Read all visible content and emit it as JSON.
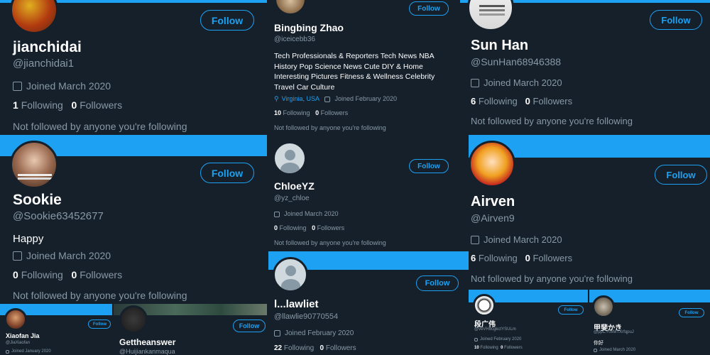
{
  "colors": {
    "bg": "#15202b",
    "accent": "#1da1f2",
    "muted": "#8899a6",
    "text": "#ffffff"
  },
  "follow_label": "Follow",
  "profiles": {
    "jianchidai": {
      "name": "jianchidai",
      "handle": "@jianchidai1",
      "joined": "Joined March 2020",
      "following": "1",
      "followers": "0",
      "following_label": "Following",
      "followers_label": "Followers",
      "note": "Not followed by anyone you're following"
    },
    "bingbing": {
      "name": "Bingbing Zhao",
      "handle": "@iceicebb36",
      "bio": "Tech Professionals & Reporters Tech News NBA History Pop Science News Cute DIY & Home Interesting Pictures Fitness & Wellness Celebrity Travel Car Culture",
      "location": "Virginia, USA",
      "joined": "Joined February 2020",
      "following": "10",
      "followers": "0",
      "following_label": "Following",
      "followers_label": "Followers",
      "note": "Not followed by anyone you're following"
    },
    "sunhan": {
      "name": "Sun Han",
      "handle": "@SunHan68946388",
      "joined": "Joined March 2020",
      "following": "6",
      "followers": "0",
      "following_label": "Following",
      "followers_label": "Followers",
      "note": "Not followed by anyone you're following"
    },
    "sookie": {
      "name": "Sookie",
      "handle": "@Sookie63452677",
      "bio": "Happy",
      "joined": "Joined March 2020",
      "following": "0",
      "followers": "0",
      "following_label": "Following",
      "followers_label": "Followers",
      "note": "Not followed by anyone you're following"
    },
    "chloe": {
      "name": "ChloeYZ",
      "handle": "@yz_chloe",
      "joined": "Joined March 2020",
      "following": "0",
      "followers": "0",
      "following_label": "Following",
      "followers_label": "Followers",
      "note": "Not followed by anyone you're following"
    },
    "airven": {
      "name": "Airven",
      "handle": "@Airven9",
      "joined": "Joined March 2020",
      "following": "6",
      "followers": "0",
      "following_label": "Following",
      "followers_label": "Followers",
      "note": "Not followed by anyone you're following"
    },
    "llawliet": {
      "name": "l...lawliet",
      "handle": "@llawlie90770554",
      "joined": "Joined February 2020",
      "following": "22",
      "followers": "0",
      "following_label": "Following",
      "followers_label": "Followers"
    },
    "xiaofan": {
      "name": "Xiaofan Jia",
      "handle": "@JiaXiaofan",
      "joined": "Joined January 2020"
    },
    "gettheanswer": {
      "name": "Gettheanswer",
      "handle": "@Huijiankanmaqua"
    },
    "duanguangwei": {
      "name": "段广伟",
      "handle": "@veVH8cgkctYSULm",
      "joined": "Joined February 2020",
      "following": "10",
      "followers": "0",
      "following_label": "Following",
      "followers_label": "Followers"
    },
    "kaikaki": {
      "name": "甲斐かき",
      "handle": "@ppCY0xMTXrfqpuJ",
      "bio": "你好",
      "joined": "Joined March 2020"
    }
  }
}
